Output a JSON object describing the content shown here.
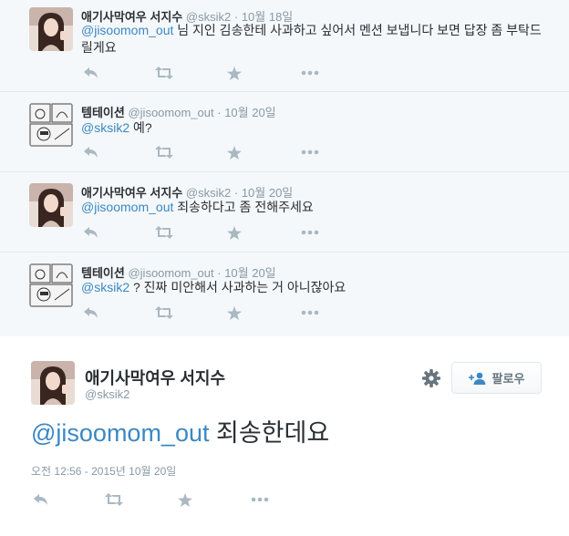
{
  "conversation": [
    {
      "fullname": "애기사막여우 서지수",
      "username": "@sksik2",
      "time": "10월 18일",
      "avatar_icon": "girl-avatar",
      "mention": "@jisoomom_out",
      "text_after": " 님 지인 김송한테 사과하고 싶어서 멘션 보냅니다 보면 답장 좀 부탁드릴게요"
    },
    {
      "fullname": "템테이션",
      "username": "@jisoomom_out",
      "time": "10월 20일",
      "avatar_icon": "comic-avatar",
      "mention": "@sksik2",
      "text_after": " 예?"
    },
    {
      "fullname": "애기사막여우 서지수",
      "username": "@sksik2",
      "time": "10월 20일",
      "avatar_icon": "girl-avatar",
      "mention": "@jisoomom_out",
      "text_after": " 죄송하다고 좀 전해주세요"
    },
    {
      "fullname": "템테이션",
      "username": "@jisoomom_out",
      "time": "10월 20일",
      "avatar_icon": "comic-avatar",
      "mention": "@sksik2",
      "text_after": " ? 진짜 미안해서 사과하는 거 아니잖아요"
    }
  ],
  "separator": "·",
  "main_tweet": {
    "fullname": "애기사막여우 서지수",
    "username": "@sksik2",
    "follow_label": "팔로우",
    "mention": "@jisoomom_out",
    "text_after": " 죄송한데요",
    "timestamp": "오전 12:56 - 2015년 10월 20일"
  },
  "colors": {
    "link": "#3b88c3",
    "background_conversation": "#f5f8fa",
    "icon": "#aab8c2"
  }
}
